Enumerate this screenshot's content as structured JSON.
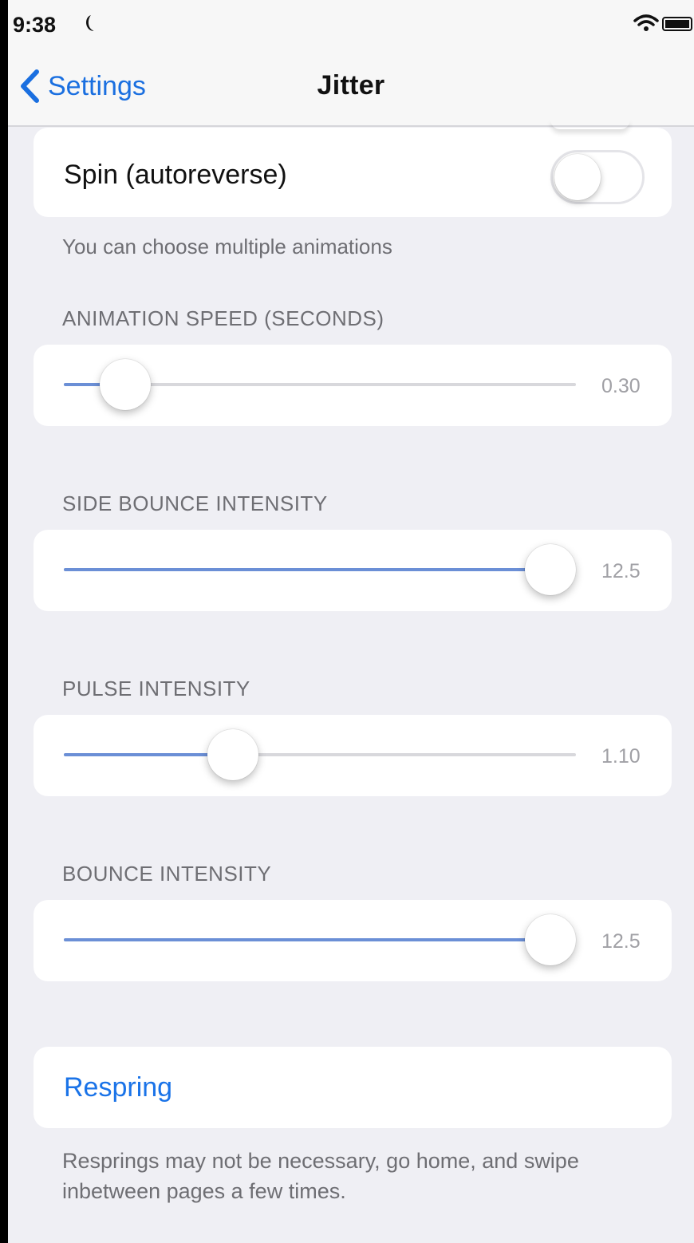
{
  "status_bar": {
    "time": "9:38"
  },
  "nav": {
    "back_label": "Settings",
    "title": "Jitter"
  },
  "spin_row": {
    "label": "Spin (autoreverse)",
    "toggle_on": false
  },
  "animations_footer": "You can choose multiple animations",
  "sliders": [
    {
      "header": "ANIMATION SPEED (SECONDS)",
      "value_text": "0.30",
      "fraction": 0.12
    },
    {
      "header": "SIDE BOUNCE INTENSITY",
      "value_text": "12.5",
      "fraction": 0.95
    },
    {
      "header": "PULSE INTENSITY",
      "value_text": "1.10",
      "fraction": 0.33
    },
    {
      "header": "BOUNCE INTENSITY",
      "value_text": "12.5",
      "fraction": 0.95
    }
  ],
  "respring": {
    "label": "Respring",
    "footer": "Resprings may not be necessary, go home, and swipe inbetween pages a few times."
  },
  "colors": {
    "accent": "#1a6fe0",
    "slider_fill": "#6b8fd6"
  }
}
